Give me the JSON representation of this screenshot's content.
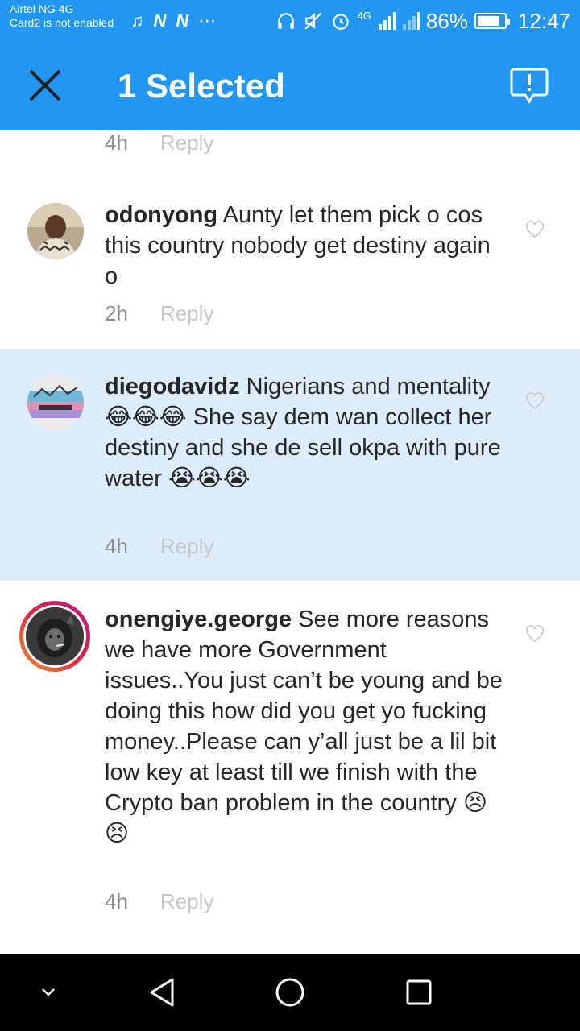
{
  "status_bar": {
    "carrier_line1": "Airtel NG 4G",
    "carrier_line2": "Card2 is not enabled",
    "network_badge": "4G",
    "battery": "86%",
    "battery_level": 0.86,
    "time": "12:47",
    "icons": [
      "music-note-icon",
      "n-icon",
      "n-icon",
      "more-dots-icon",
      "headphones-icon",
      "mute-icon",
      "alarm-icon",
      "signal-icon",
      "signal-off-icon",
      "battery-icon"
    ]
  },
  "action_bar": {
    "title": "1 Selected",
    "close_icon": "close-icon",
    "report_icon": "report-icon",
    "color": "#2196f3"
  },
  "partial_comment": {
    "time": "4h",
    "reply": "Reply"
  },
  "comments": [
    {
      "username": "odonyong",
      "text": " Aunty let them pick o cos this country nobody get destiny again o",
      "time": "2h",
      "reply": "Reply",
      "selected": false
    },
    {
      "username": "diegodavidz",
      "text": " Nigerians and mentality 😂😂😂 She say dem wan collect her destiny and she de sell okpa with pure water 😭😭😭",
      "time": "4h",
      "reply": "Reply",
      "selected": true
    },
    {
      "username": "onengiye.george",
      "text": " See more reasons we have more Government issues..You just can’t be young and be doing this how did you get yo fucking money..Please can y’all just be a lil bit low key at least till we finish with the Crypto ban problem in the country 😣😣",
      "time": "4h",
      "reply": "Reply",
      "selected": false
    }
  ],
  "nav_bar": {
    "buttons": [
      "hide-keyboard-icon",
      "back-icon",
      "home-icon",
      "recents-icon"
    ]
  }
}
